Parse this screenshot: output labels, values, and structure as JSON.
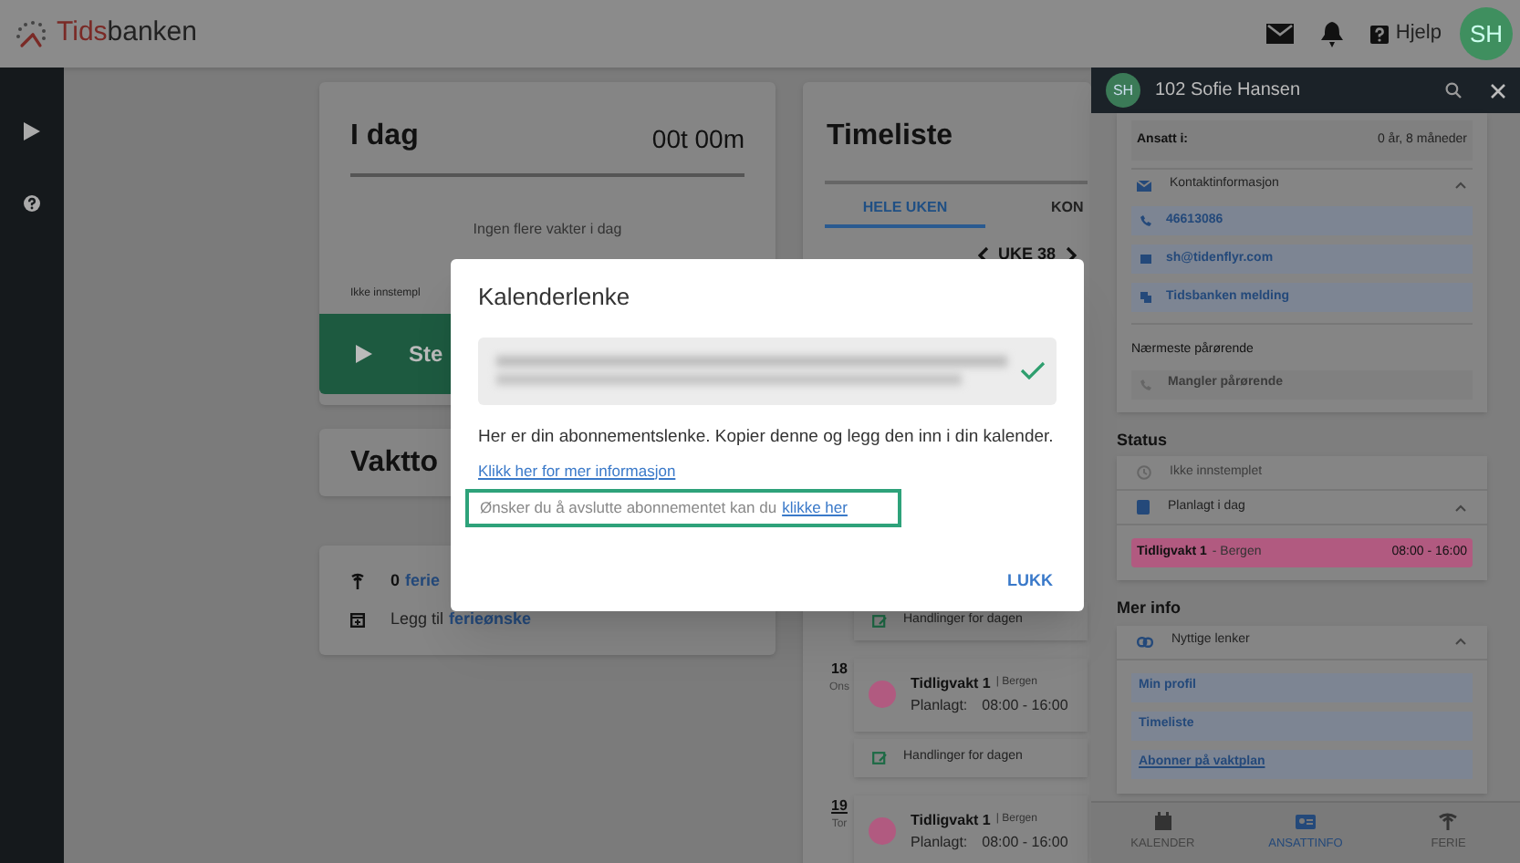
{
  "app": {
    "logo_prefix": "Tids",
    "logo_suffix": "banken",
    "help": "Hjelp",
    "avatar": "SH"
  },
  "today_card": {
    "title": "I dag",
    "duration": "00t 00m",
    "empty": "Ingen flere vakter i dag",
    "status": "Ikke innstempl",
    "button": "Ste"
  },
  "roster_card": {
    "title": "Vaktto"
  },
  "vacation_card": {
    "count": "0",
    "link": "ferie",
    "add_prefix": "Legg til",
    "add_link": "ferieønske"
  },
  "timesheet": {
    "title": "Timeliste",
    "tabs": [
      {
        "label": "HELE UKEN",
        "selected": true
      },
      {
        "label": "KON",
        "selected": false
      }
    ],
    "week": "UKE 38",
    "entries": [
      {
        "kind": "actions",
        "label": "Handlinger for dagen"
      },
      {
        "kind": "shift",
        "day": "18",
        "weekday": "Ons",
        "today": false,
        "title": "Tidligvakt 1",
        "place": "| Bergen",
        "planned_label": "Planlagt:",
        "time": "08:00 - 16:00",
        "color": "#b15a80"
      },
      {
        "kind": "actions",
        "label": "Handlinger for dagen"
      },
      {
        "kind": "shift",
        "day": "19",
        "weekday": "Tor",
        "today": true,
        "title": "Tidligvakt 1",
        "place": "| Bergen",
        "planned_label": "Planlagt:",
        "time": "08:00 - 16:00",
        "color": "#b15a80"
      }
    ]
  },
  "employee_panel": {
    "avatar": "SH",
    "name": "102 Sofie Hansen",
    "employed_label": "Ansatt i:",
    "employed_value": "0 år, 8 måneder",
    "contact": {
      "title": "Kontaktinformasjon",
      "expanded": true,
      "items": [
        {
          "kind": "phone",
          "label": "46613086"
        },
        {
          "kind": "email",
          "label": "sh@tidenflyr.com"
        },
        {
          "kind": "message",
          "label": "Tidsbanken melding"
        }
      ]
    },
    "next_of_kin": {
      "title": "Nærmeste pårørende",
      "value": "Mangler pårørende"
    },
    "status": {
      "title": "Status",
      "clock": "Ikke innstemplet",
      "planned_title": "Planlagt i dag",
      "planned_expanded": true,
      "shift": {
        "title": "Tidligvakt 1",
        "place": "- Bergen",
        "time": "08:00 - 16:00",
        "color": "#b15a80"
      }
    },
    "more": {
      "title": "Mer info",
      "links_title": "Nyttige lenker",
      "expanded": true,
      "links": [
        "Min profil",
        "Timeliste",
        "Abonner på vaktplan"
      ]
    },
    "nav": [
      {
        "kind": "calendar",
        "label": "KALENDER",
        "selected": false
      },
      {
        "kind": "idcard",
        "label": "ANSATTINFO",
        "selected": true
      },
      {
        "kind": "palm",
        "label": "FERIE",
        "selected": false
      }
    ]
  },
  "dialog": {
    "title": "Kalenderlenke",
    "copied": true,
    "text": "Her er din abonnementslenke. Kopier denne og legg den inn i din kalender.",
    "info_link": "Klikk her for mer informasjon",
    "unsubscribe": {
      "text": "Ønsker du å avslutte abonnementet kan du",
      "link": "klikke her",
      "highlighted": true
    },
    "close": "LUKK"
  }
}
